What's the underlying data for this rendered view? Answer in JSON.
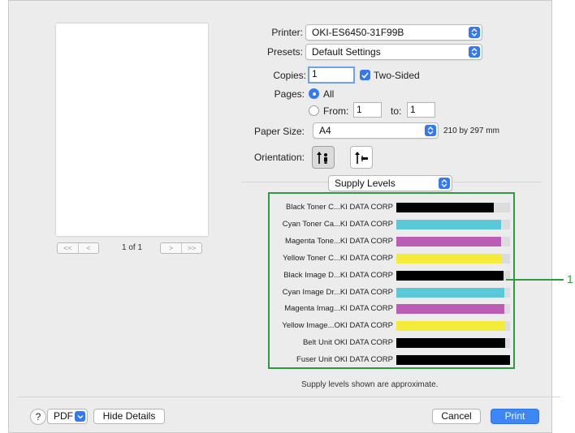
{
  "preview": {
    "page_count": "1 of 1",
    "first_prev": [
      "<<",
      "<"
    ],
    "next_last": [
      ">",
      ">>"
    ]
  },
  "form": {
    "printer_label": "Printer:",
    "printer_value": "OKI-ES6450-31F99B",
    "presets_label": "Presets:",
    "presets_value": "Default Settings",
    "copies_label": "Copies:",
    "copies_value": "1",
    "two_sided_label": "Two-Sided",
    "two_sided_checked": true,
    "pages_label": "Pages:",
    "pages_all_label": "All",
    "pages_from_label": "From:",
    "pages_from_value": "1",
    "pages_to_label": "to:",
    "pages_to_value": "1",
    "paper_size_label": "Paper Size:",
    "paper_size_value": "A4",
    "paper_size_dims": "210 by 297 mm",
    "orientation_label": "Orientation:",
    "orientation_selected": "portrait",
    "section_value": "Supply Levels"
  },
  "supplies": [
    {
      "name": "Black Toner C...KI DATA CORP",
      "level": 0.86,
      "color": "#000000"
    },
    {
      "name": "Cyan Toner Ca...KI DATA CORP",
      "level": 0.92,
      "color": "#5ac8d8"
    },
    {
      "name": "Magenta Tone...KI DATA CORP",
      "level": 0.92,
      "color": "#bb5cb5"
    },
    {
      "name": "Yellow Toner C...KI DATA CORP",
      "level": 0.92,
      "color": "#f3ec3b"
    },
    {
      "name": "Black Image D...KI DATA CORP",
      "level": 0.94,
      "color": "#000000"
    },
    {
      "name": "Cyan Image Dr...KI DATA CORP",
      "level": 0.95,
      "color": "#5ac8d8"
    },
    {
      "name": "Magenta Imag...KI DATA CORP",
      "level": 0.95,
      "color": "#bb5cb5"
    },
    {
      "name": "Yellow Image...OKI DATA CORP",
      "level": 0.95,
      "color": "#f3ec3b"
    },
    {
      "name": "Belt Unit OKI DATA CORP",
      "level": 0.96,
      "color": "#000000"
    },
    {
      "name": "Fuser Unit OKI DATA CORP",
      "level": 1.0,
      "color": "#000000"
    }
  ],
  "supply_note": "Supply levels shown are approximate.",
  "callout_label": "1",
  "footer": {
    "help_label": "?",
    "pdf_label": "PDF",
    "hide_details_label": "Hide Details",
    "cancel_label": "Cancel",
    "print_label": "Print"
  },
  "colors": {
    "accent": "#3478f6",
    "callout": "#2f9a42"
  }
}
